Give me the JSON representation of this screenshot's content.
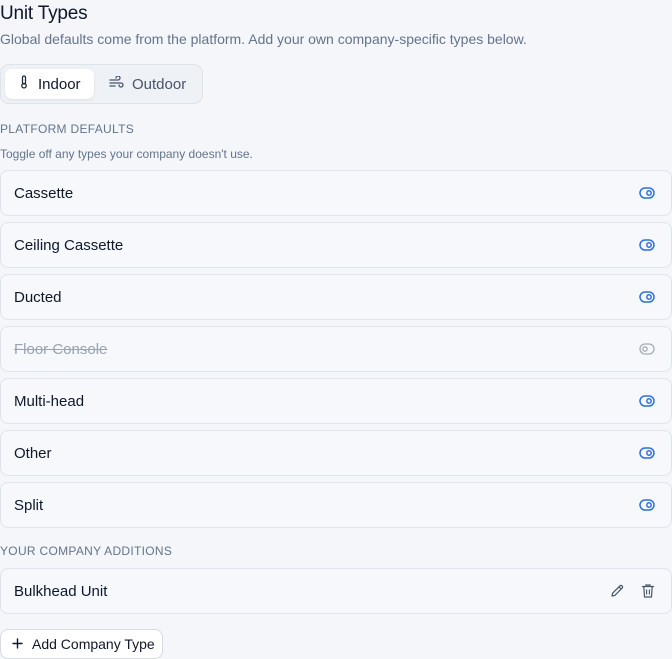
{
  "header": {
    "title": "Unit Types",
    "subtitle": "Global defaults come from the platform. Add your own company-specific types below."
  },
  "tabs": [
    {
      "label": "Indoor",
      "icon": "thermometer-icon",
      "active": true
    },
    {
      "label": "Outdoor",
      "icon": "wind-icon",
      "active": false
    }
  ],
  "platform": {
    "heading": "PLATFORM DEFAULTS",
    "hint": "Toggle off any types your company doesn't use.",
    "items": [
      {
        "label": "Cassette",
        "enabled": true
      },
      {
        "label": "Ceiling Cassette",
        "enabled": true
      },
      {
        "label": "Ducted",
        "enabled": true
      },
      {
        "label": "Floor Console",
        "enabled": false
      },
      {
        "label": "Multi-head",
        "enabled": true
      },
      {
        "label": "Other",
        "enabled": true
      },
      {
        "label": "Split",
        "enabled": true
      }
    ]
  },
  "company": {
    "heading": "YOUR COMPANY ADDITIONS",
    "items": [
      {
        "label": "Bulkhead Unit"
      }
    ],
    "add_label": "Add Company Type"
  },
  "colors": {
    "toggle_on": "#2f6fe0",
    "toggle_off": "#a6adb7",
    "text": "#0f172a",
    "muted": "#64748b"
  }
}
